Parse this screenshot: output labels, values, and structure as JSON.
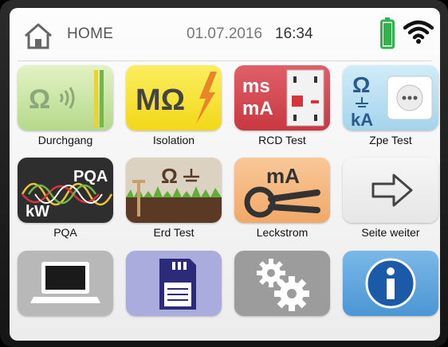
{
  "header": {
    "home_label": "HOME",
    "date": "01.07.2016",
    "time": "16:34",
    "battery_color": "#2fb34a"
  },
  "tiles": [
    {
      "label": "Durchgang",
      "icon": "continuity-icon",
      "color": "#c8e6a0",
      "glyph": "Ω"
    },
    {
      "label": "Isolation",
      "icon": "insulation-icon",
      "color": "#f6e23a",
      "glyph": "MΩ"
    },
    {
      "label": "RCD Test",
      "icon": "rcd-icon",
      "color": "#d9464e",
      "glyph": [
        "ms",
        "mA"
      ]
    },
    {
      "label": "Zpe Test",
      "icon": "zpe-icon",
      "color": "#b8dff0",
      "glyph": [
        "Ω",
        "kA"
      ]
    },
    {
      "label": "PQA",
      "icon": "pqa-icon",
      "color": "#2e2e2e",
      "glyph": [
        "PQA",
        "kW"
      ]
    },
    {
      "label": "Erd Test",
      "icon": "earth-test-icon",
      "color": "#d8ccb8",
      "glyph": "Ω"
    },
    {
      "label": "Leckstrom",
      "icon": "leakage-clamp-icon",
      "color": "#f6b37a",
      "glyph": "mA"
    },
    {
      "label": "Seite weiter",
      "icon": "arrow-right-icon",
      "color": "#eeeeee",
      "glyph": ""
    },
    {
      "label": "",
      "icon": "laptop-icon",
      "color": "#b5b5b5",
      "glyph": ""
    },
    {
      "label": "",
      "icon": "sd-card-icon",
      "color": "#a7a9d8",
      "glyph": ""
    },
    {
      "label": "",
      "icon": "gears-icon",
      "color": "#9a9a9a",
      "glyph": ""
    },
    {
      "label": "",
      "icon": "info-icon",
      "color": "#5aa6e0",
      "glyph": ""
    }
  ]
}
